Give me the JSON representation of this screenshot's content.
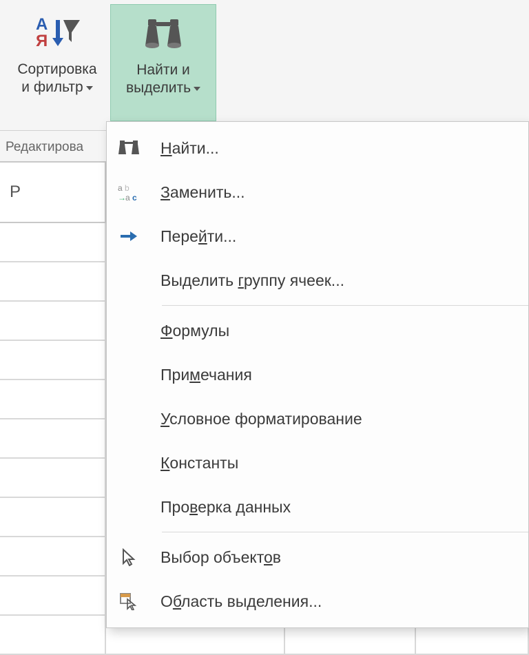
{
  "ribbon": {
    "sort_filter": {
      "line1": "Сортировка",
      "line2": "и фильтр"
    },
    "find_select": {
      "line1": "Найти и",
      "line2": "выделить"
    },
    "group_caption": "Редактирова"
  },
  "column_header": {
    "p": "P"
  },
  "menu": {
    "find": "Найти...",
    "replace": "Заменить...",
    "goto": "Перейти...",
    "goto_special": "Выделить группу ячеек...",
    "formulas": "Формулы",
    "comments": "Примечания",
    "cond_fmt": "Условное форматирование",
    "constants": "Константы",
    "validation": "Проверка данных",
    "select_obj": "Выбор объектов",
    "sel_pane": "Область выделения..."
  },
  "underline": {
    "find": 0,
    "replace": 0,
    "goto": 4,
    "goto_special": 9,
    "formulas": 0,
    "comments": 3,
    "cond_fmt": 0,
    "constants": 0,
    "validation": 3,
    "select_obj": 12,
    "sel_pane": 1
  }
}
